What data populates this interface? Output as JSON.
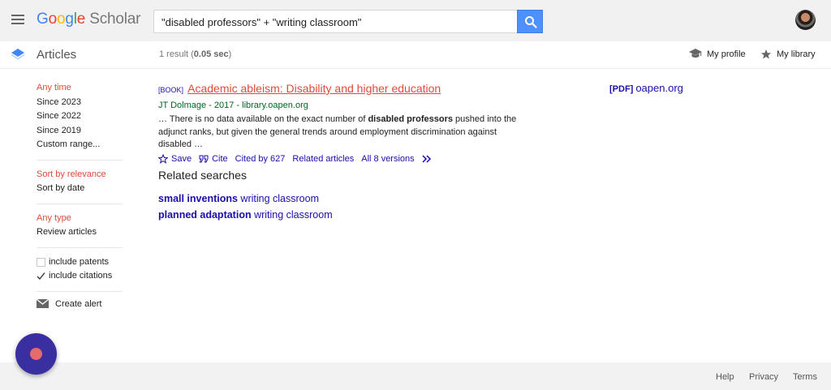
{
  "header": {
    "logo_google": [
      "G",
      "o",
      "o",
      "g",
      "l",
      "e"
    ],
    "logo_scholar": "Scholar",
    "search_query": "\"disabled professors\" + \"writing classroom\"",
    "menu_icon": "hamburger-menu-icon",
    "search_icon": "magnifier-icon",
    "accent": "#4d90fe"
  },
  "subbar": {
    "section_title": "Articles",
    "result_count_prefix": "1 result (",
    "result_time": "0.05 sec",
    "result_count_suffix": ")",
    "my_profile": "My profile",
    "my_library": "My library"
  },
  "sidebar": {
    "time_filters": [
      "Any time",
      "Since 2023",
      "Since 2022",
      "Since 2019",
      "Custom range..."
    ],
    "sort_options": [
      "Sort by relevance",
      "Sort by date"
    ],
    "type_filters": [
      "Any type",
      "Review articles"
    ],
    "checkboxes": [
      {
        "label": "include patents",
        "checked": false
      },
      {
        "label": "include citations",
        "checked": true
      }
    ],
    "create_alert": "Create alert",
    "active_color": "#dd4b39"
  },
  "result": {
    "type_tag": "[BOOK]",
    "title": "Academic ableism: Disability and higher education",
    "meta": "JT Dolmage - 2017 - library.oapen.org",
    "snippet_line1_pre": "… There is no data available on the exact number of ",
    "snippet_line1_bold": "disabled professors",
    "snippet_line1_post": " pushed into the",
    "snippet_line2": "adjunct ranks, but given the general trends around employment discrimination against disabled …",
    "actions": {
      "save": "Save",
      "cite": "Cite",
      "cited_by": "Cited by 627",
      "related": "Related articles",
      "versions": "All 8 versions"
    },
    "pdf_tag": "[PDF]",
    "pdf_source": "oapen.org"
  },
  "related_searches": {
    "heading": "Related searches",
    "items": [
      {
        "bold": "small inventions",
        "rest": " writing classroom"
      },
      {
        "bold": "planned adaptation",
        "rest": " writing classroom"
      }
    ]
  },
  "footer": {
    "help": "Help",
    "privacy": "Privacy",
    "terms": "Terms"
  }
}
